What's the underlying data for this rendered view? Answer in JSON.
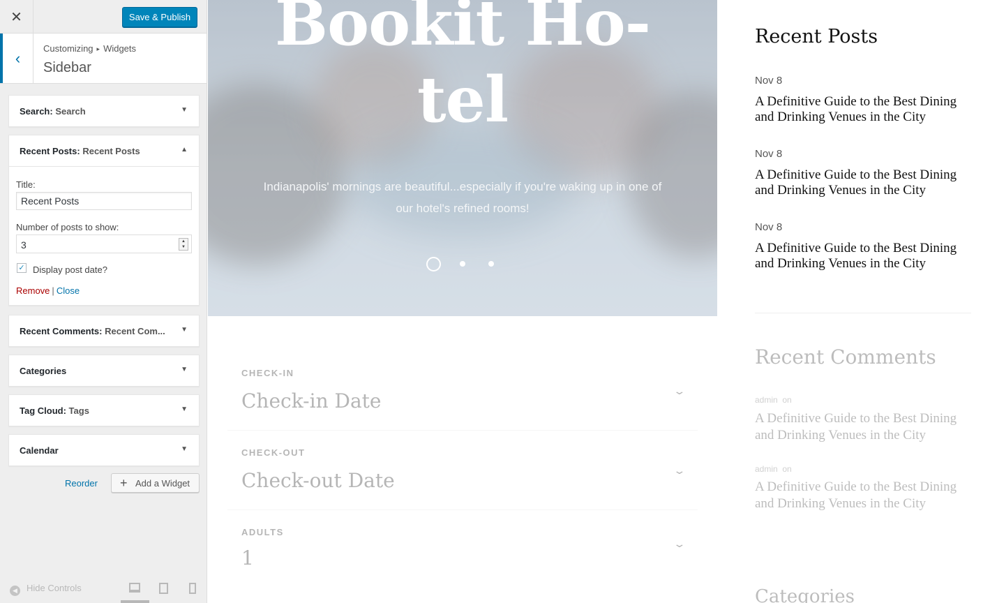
{
  "customizer": {
    "close_icon": "close-icon",
    "save_publish": "Save & Publish",
    "breadcrumb": {
      "part1": "Customizing",
      "separator": "▸",
      "part2": "Widgets"
    },
    "section_title": "Sidebar",
    "widgets": [
      {
        "name": "Search",
        "sub": "Search",
        "expanded": false
      },
      {
        "name": "Recent Posts",
        "sub": "Recent Posts",
        "expanded": true
      },
      {
        "name": "Recent Comments",
        "sub": "Recent Com...",
        "expanded": false
      },
      {
        "name": "Categories",
        "sub": "",
        "expanded": false
      },
      {
        "name": "Tag Cloud",
        "sub": "Tags",
        "expanded": false
      },
      {
        "name": "Calendar",
        "sub": "",
        "expanded": false
      }
    ],
    "recent_posts_form": {
      "title_label": "Title:",
      "title_value": "Recent Posts",
      "count_label": "Number of posts to show:",
      "count_value": "3",
      "display_date_label": "Display post date?",
      "display_date_checked": true,
      "remove": "Remove",
      "separator": "|",
      "close": "Close"
    },
    "reorder": "Reorder",
    "add_widget": "Add a Widget",
    "hide_controls": "Hide Controls",
    "accent_color": "#0073aa",
    "button_color": "#0085ba",
    "remove_color": "#aa0000"
  },
  "preview": {
    "hero": {
      "title_line1": "Bookit Ho-",
      "title_line2": "tel",
      "subtitle": "Indianapolis' mornings are beautiful...especially if you're waking up in one of our hotel's refined rooms!",
      "slides": 3,
      "active_slide": 1
    },
    "booking": [
      {
        "label": "CHECK-IN",
        "value": "Check-in Date"
      },
      {
        "label": "CHECK-OUT",
        "value": "Check-out Date"
      },
      {
        "label": "ADULTS",
        "value": "1"
      }
    ],
    "recent_posts": {
      "title": "Recent Posts",
      "items": [
        {
          "date": "Nov 8",
          "title": "A Definitive Guide to the Best Dining and Drinking Venues in the City"
        },
        {
          "date": "Nov 8",
          "title": "A Definitive Guide to the Best Dining and Drinking Venues in the City"
        },
        {
          "date": "Nov 8",
          "title": "A Definitive Guide to the Best Dining and Drinking Venues in the City"
        }
      ]
    },
    "recent_comments": {
      "title": "Recent Comments",
      "items": [
        {
          "author": "admin",
          "on": "on",
          "title": "A Definitive Guide to the Best Dining and Drinking Venues in the City"
        },
        {
          "author": "admin",
          "on": "on",
          "title": "A Definitive Guide to the Best Dining and Drinking Venues in the City"
        }
      ]
    },
    "categories_title": "Categories"
  }
}
